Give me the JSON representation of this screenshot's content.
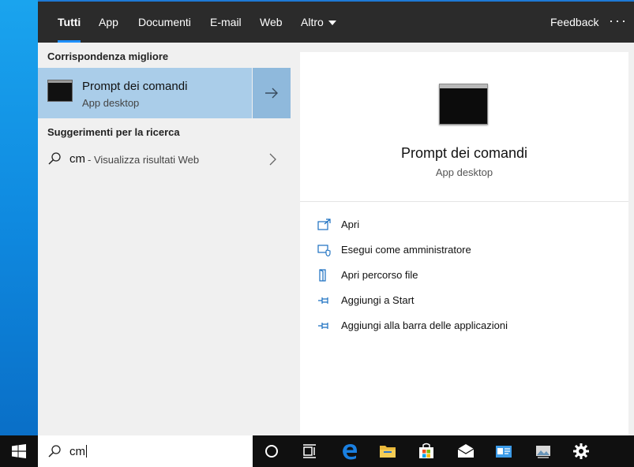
{
  "nav": {
    "tabs": [
      {
        "label": "Tutti",
        "active": true
      },
      {
        "label": "App"
      },
      {
        "label": "Documenti"
      },
      {
        "label": "E-mail"
      },
      {
        "label": "Web"
      },
      {
        "label": "Altro"
      }
    ],
    "feedback_label": "Feedback",
    "more_label": "···"
  },
  "best_match": {
    "section_title": "Corrispondenza migliore",
    "title": "Prompt dei comandi",
    "subtitle": "App desktop",
    "icon": "command-prompt-icon"
  },
  "suggestions": {
    "section_title": "Suggerimenti per la ricerca",
    "items": [
      {
        "query": "cm",
        "rest": " - Visualizza risultati Web",
        "icon": "search-icon"
      }
    ]
  },
  "detail": {
    "title": "Prompt dei comandi",
    "subtitle": "App desktop",
    "actions": [
      {
        "label": "Apri",
        "icon": "open-icon"
      },
      {
        "label": "Esegui come amministratore",
        "icon": "run-as-admin-icon"
      },
      {
        "label": "Apri percorso file",
        "icon": "open-file-location-icon"
      },
      {
        "label": "Aggiungi a Start",
        "icon": "pin-icon"
      },
      {
        "label": "Aggiungi alla barra delle applicazioni",
        "icon": "pin-taskbar-icon"
      }
    ]
  },
  "taskbar": {
    "search_value": "cm",
    "icons": [
      "windows-logo-icon",
      "cortana-icon",
      "task-view-icon",
      "edge-icon",
      "file-explorer-icon",
      "store-icon",
      "mail-icon",
      "contact-card-icon",
      "photo-viewer-icon",
      "settings-gear-icon"
    ]
  },
  "colors": {
    "accent": "#1e90ff",
    "selected_row": "#aacde9",
    "selected_arrow": "#8fb9dc",
    "nav_bg": "#2b2b2b",
    "taskbar_bg": "#101010"
  }
}
